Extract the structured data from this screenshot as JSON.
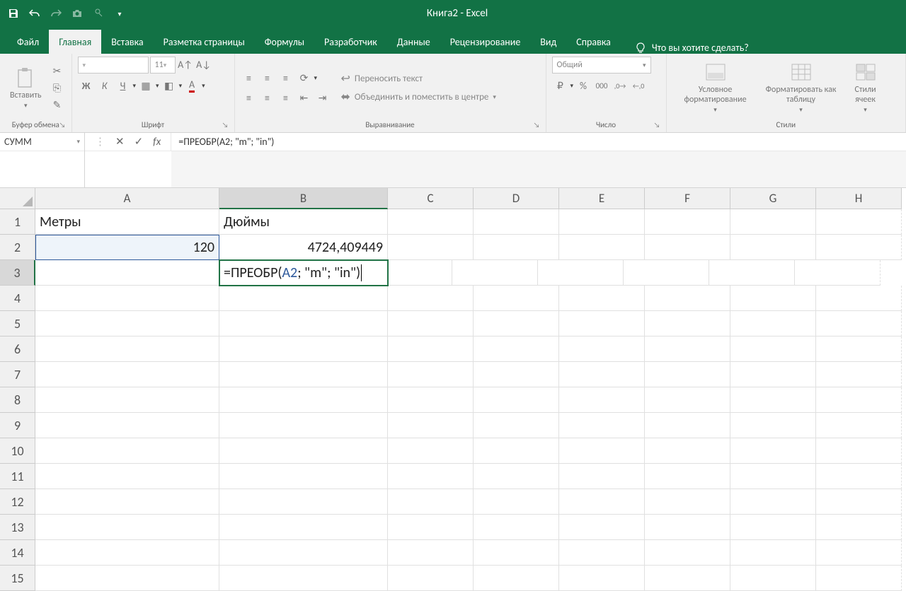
{
  "title": "Книга2  -  Excel",
  "qat": {
    "save": "💾",
    "undo": "↶",
    "redo": "↷"
  },
  "tabs": {
    "file": "Файл",
    "home": "Главная",
    "insert": "Вставка",
    "layout": "Разметка страницы",
    "formulas": "Формулы",
    "developer": "Разработчик",
    "data": "Данные",
    "review": "Рецензирование",
    "view": "Вид",
    "help": "Справка",
    "tell_me": "Что вы хотите сделать?"
  },
  "ribbon": {
    "clipboard": {
      "paste": "Вставить",
      "label": "Буфер обмена"
    },
    "font": {
      "label": "Шрифт",
      "size": "11",
      "bold": "Ж",
      "italic": "К",
      "underline": "Ч"
    },
    "alignment": {
      "label": "Выравнивание",
      "wrap": "Переносить текст",
      "merge": "Объединить и поместить в центре"
    },
    "number": {
      "label": "Число",
      "format": "Общий"
    },
    "styles": {
      "label": "Стили",
      "conditional": "Условное форматирование",
      "table": "Форматировать как таблицу",
      "cell": "Стили ячеек"
    }
  },
  "name_box": "СУММ",
  "formula_bar": "=ПРЕОБР(A2; \"m\"; \"in\")",
  "columns": [
    "A",
    "B",
    "C",
    "D",
    "E",
    "F",
    "G",
    "H"
  ],
  "rows": [
    "1",
    "2",
    "3",
    "4",
    "5",
    "6",
    "7",
    "8",
    "9",
    "10",
    "11",
    "12",
    "13",
    "14",
    "15"
  ],
  "cells": {
    "A1": "Метры",
    "B1": "Дюймы",
    "A2": "120",
    "B2": "4724,409449",
    "B3_prefix": "=ПРЕОБР(",
    "B3_ref": "A2",
    "B3_suffix": "; \"m\"; \"in\")"
  },
  "active_col": "B",
  "active_row": "3"
}
